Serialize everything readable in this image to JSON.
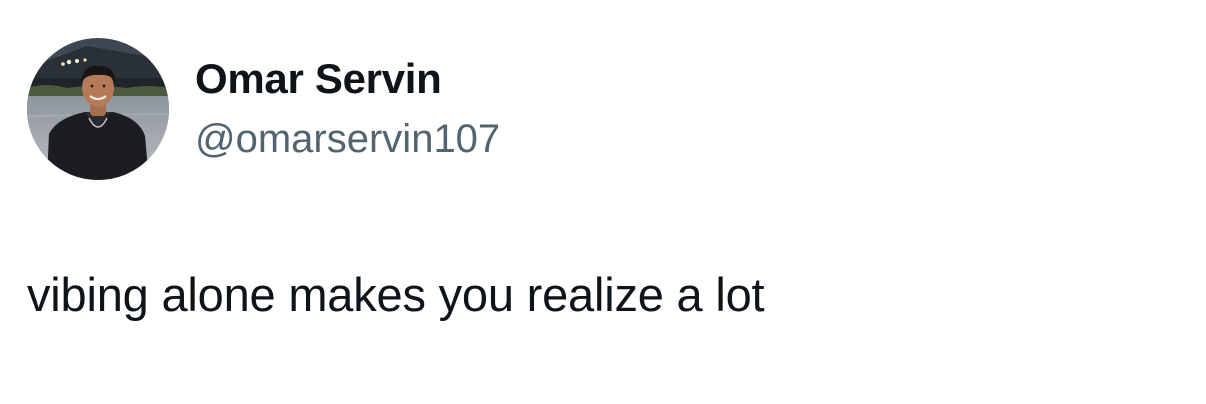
{
  "tweet": {
    "author": {
      "display_name": "Omar Servin",
      "handle": "@omarservin107",
      "avatar_icon": "profile-photo"
    },
    "text": "vibing alone makes you realize a lot"
  },
  "colors": {
    "background": "#ffffff",
    "text_primary": "#0f1419",
    "text_secondary": "#536471"
  }
}
